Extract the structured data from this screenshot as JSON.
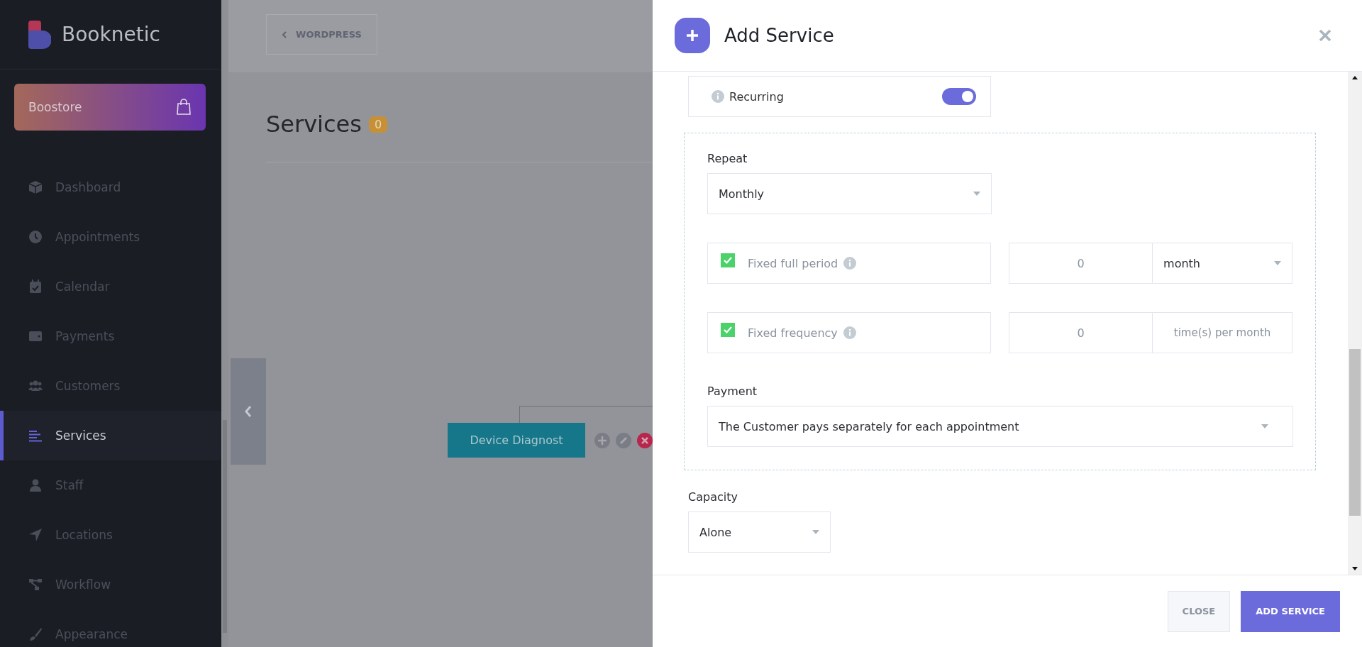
{
  "sidebar": {
    "brand": "Booknetic",
    "boostore": "Boostore",
    "items": [
      {
        "label": "Dashboard",
        "kind": "cube",
        "selected": false
      },
      {
        "label": "Appointments",
        "kind": "clock",
        "selected": false
      },
      {
        "label": "Calendar",
        "kind": "calendar",
        "selected": false
      },
      {
        "label": "Payments",
        "kind": "wallet",
        "selected": false
      },
      {
        "label": "Customers",
        "kind": "users",
        "selected": false
      },
      {
        "label": "Services",
        "kind": "lines",
        "selected": true
      },
      {
        "label": "Staff",
        "kind": "user",
        "selected": false
      },
      {
        "label": "Locations",
        "kind": "arrow",
        "selected": false
      },
      {
        "label": "Workflow",
        "kind": "flow",
        "selected": false
      },
      {
        "label": "Appearance",
        "kind": "brush",
        "selected": false
      }
    ]
  },
  "main": {
    "back_button": "WORDPRESS",
    "title": "Services",
    "count": "0",
    "node": "Device Diagnost"
  },
  "modal": {
    "title": "Add Service",
    "recurring": {
      "label": "Recurring",
      "on": true
    },
    "repeat": {
      "label": "Repeat",
      "value": "Monthly"
    },
    "rows": [
      {
        "label": "Fixed full period",
        "checked": true,
        "value": "0",
        "unit": "month",
        "kind": "select"
      },
      {
        "label": "Fixed frequency",
        "checked": true,
        "value": "0",
        "unit": "time(s) per month",
        "kind": "text"
      }
    ],
    "payment": {
      "label": "Payment",
      "value": "The Customer pays separately for each appointment"
    },
    "capacity": {
      "label": "Capacity",
      "value": "Alone"
    },
    "buttons": [
      {
        "label": "CLOSE",
        "kind": "secondary"
      },
      {
        "label": "ADD SERVICE",
        "kind": "primary"
      }
    ]
  }
}
